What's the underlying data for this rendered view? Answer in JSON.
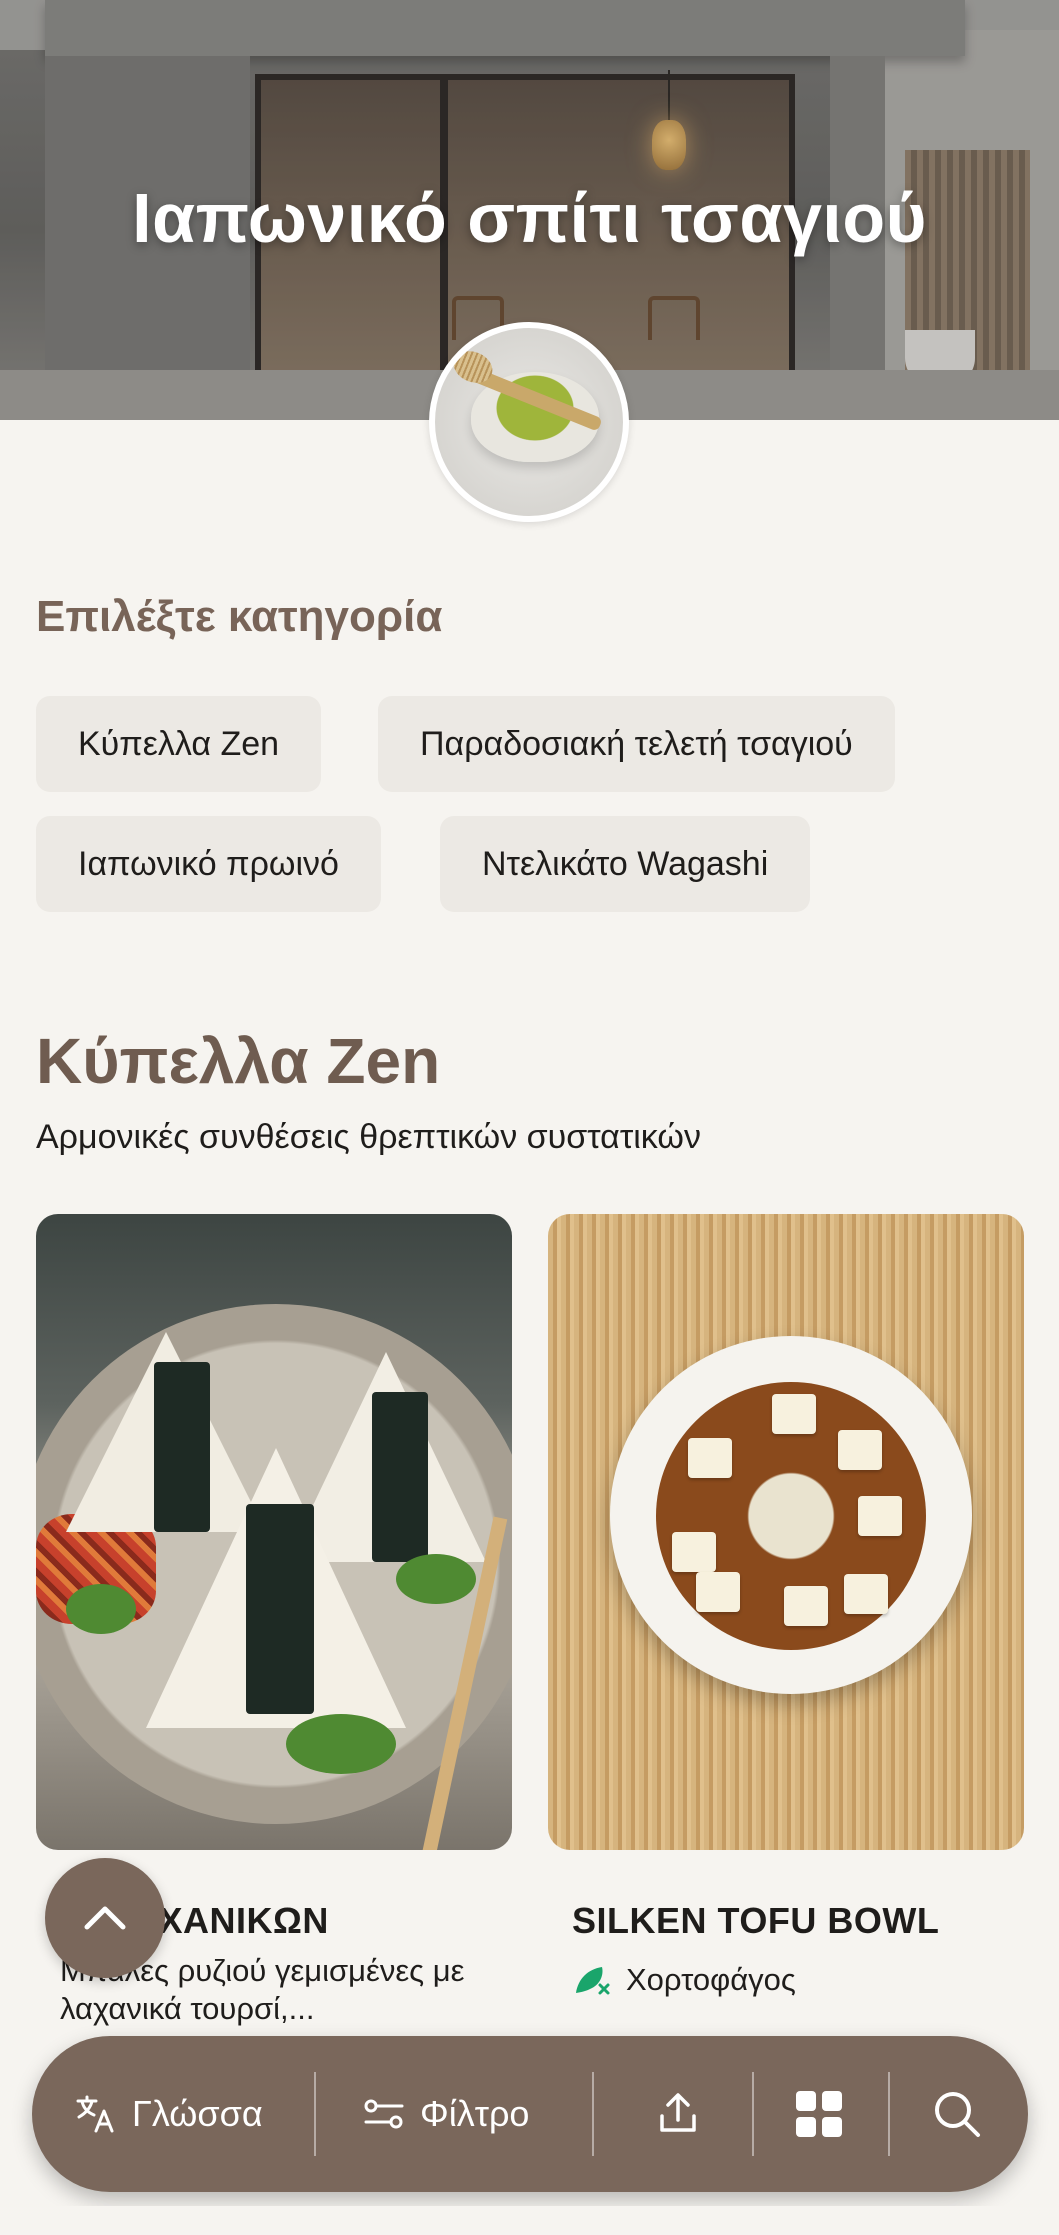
{
  "hero": {
    "title": "Ιαπωνικό σπίτι τσαγιού"
  },
  "category": {
    "heading": "Επιλέξτε κατηγορία",
    "chips": [
      {
        "label": "Κύπελλα Zen"
      },
      {
        "label": "Παραδοσιακή τελετή τσαγιού"
      },
      {
        "label": "Ιαπωνικό πρωινό"
      },
      {
        "label": "Ντελικάτο Wagashi"
      }
    ]
  },
  "section": {
    "title": "Κύπελλα Zen",
    "subtitle": "Αρμονικές συνθέσεις θρεπτικών συστατικών"
  },
  "cards": [
    {
      "title": "RI ΛΑΧΑΝΙΚΩΝ",
      "description": "Μπάλες ρυζιού γεμισμένες με λαχανικά τουρσί,..."
    },
    {
      "title": "SILKEN TOFU BOWL",
      "tag": "Χορτοφάγος"
    }
  ],
  "bottom_bar": {
    "language_label": "Γλώσσα",
    "filter_label": "Φίλτρο"
  },
  "colors": {
    "accent": "#7a675b",
    "heading": "#786458",
    "chip_bg": "#ece9e4",
    "background": "#f6f4f0",
    "veg_icon": "#1aa56b"
  },
  "icons": {
    "language": "translate-icon",
    "filter": "filter-sliders-icon",
    "share": "share-upload-icon",
    "grid": "grid-icon",
    "search": "search-icon",
    "scroll_top": "chevron-up-icon",
    "vegetarian": "vegetarian-leaf-icon"
  }
}
